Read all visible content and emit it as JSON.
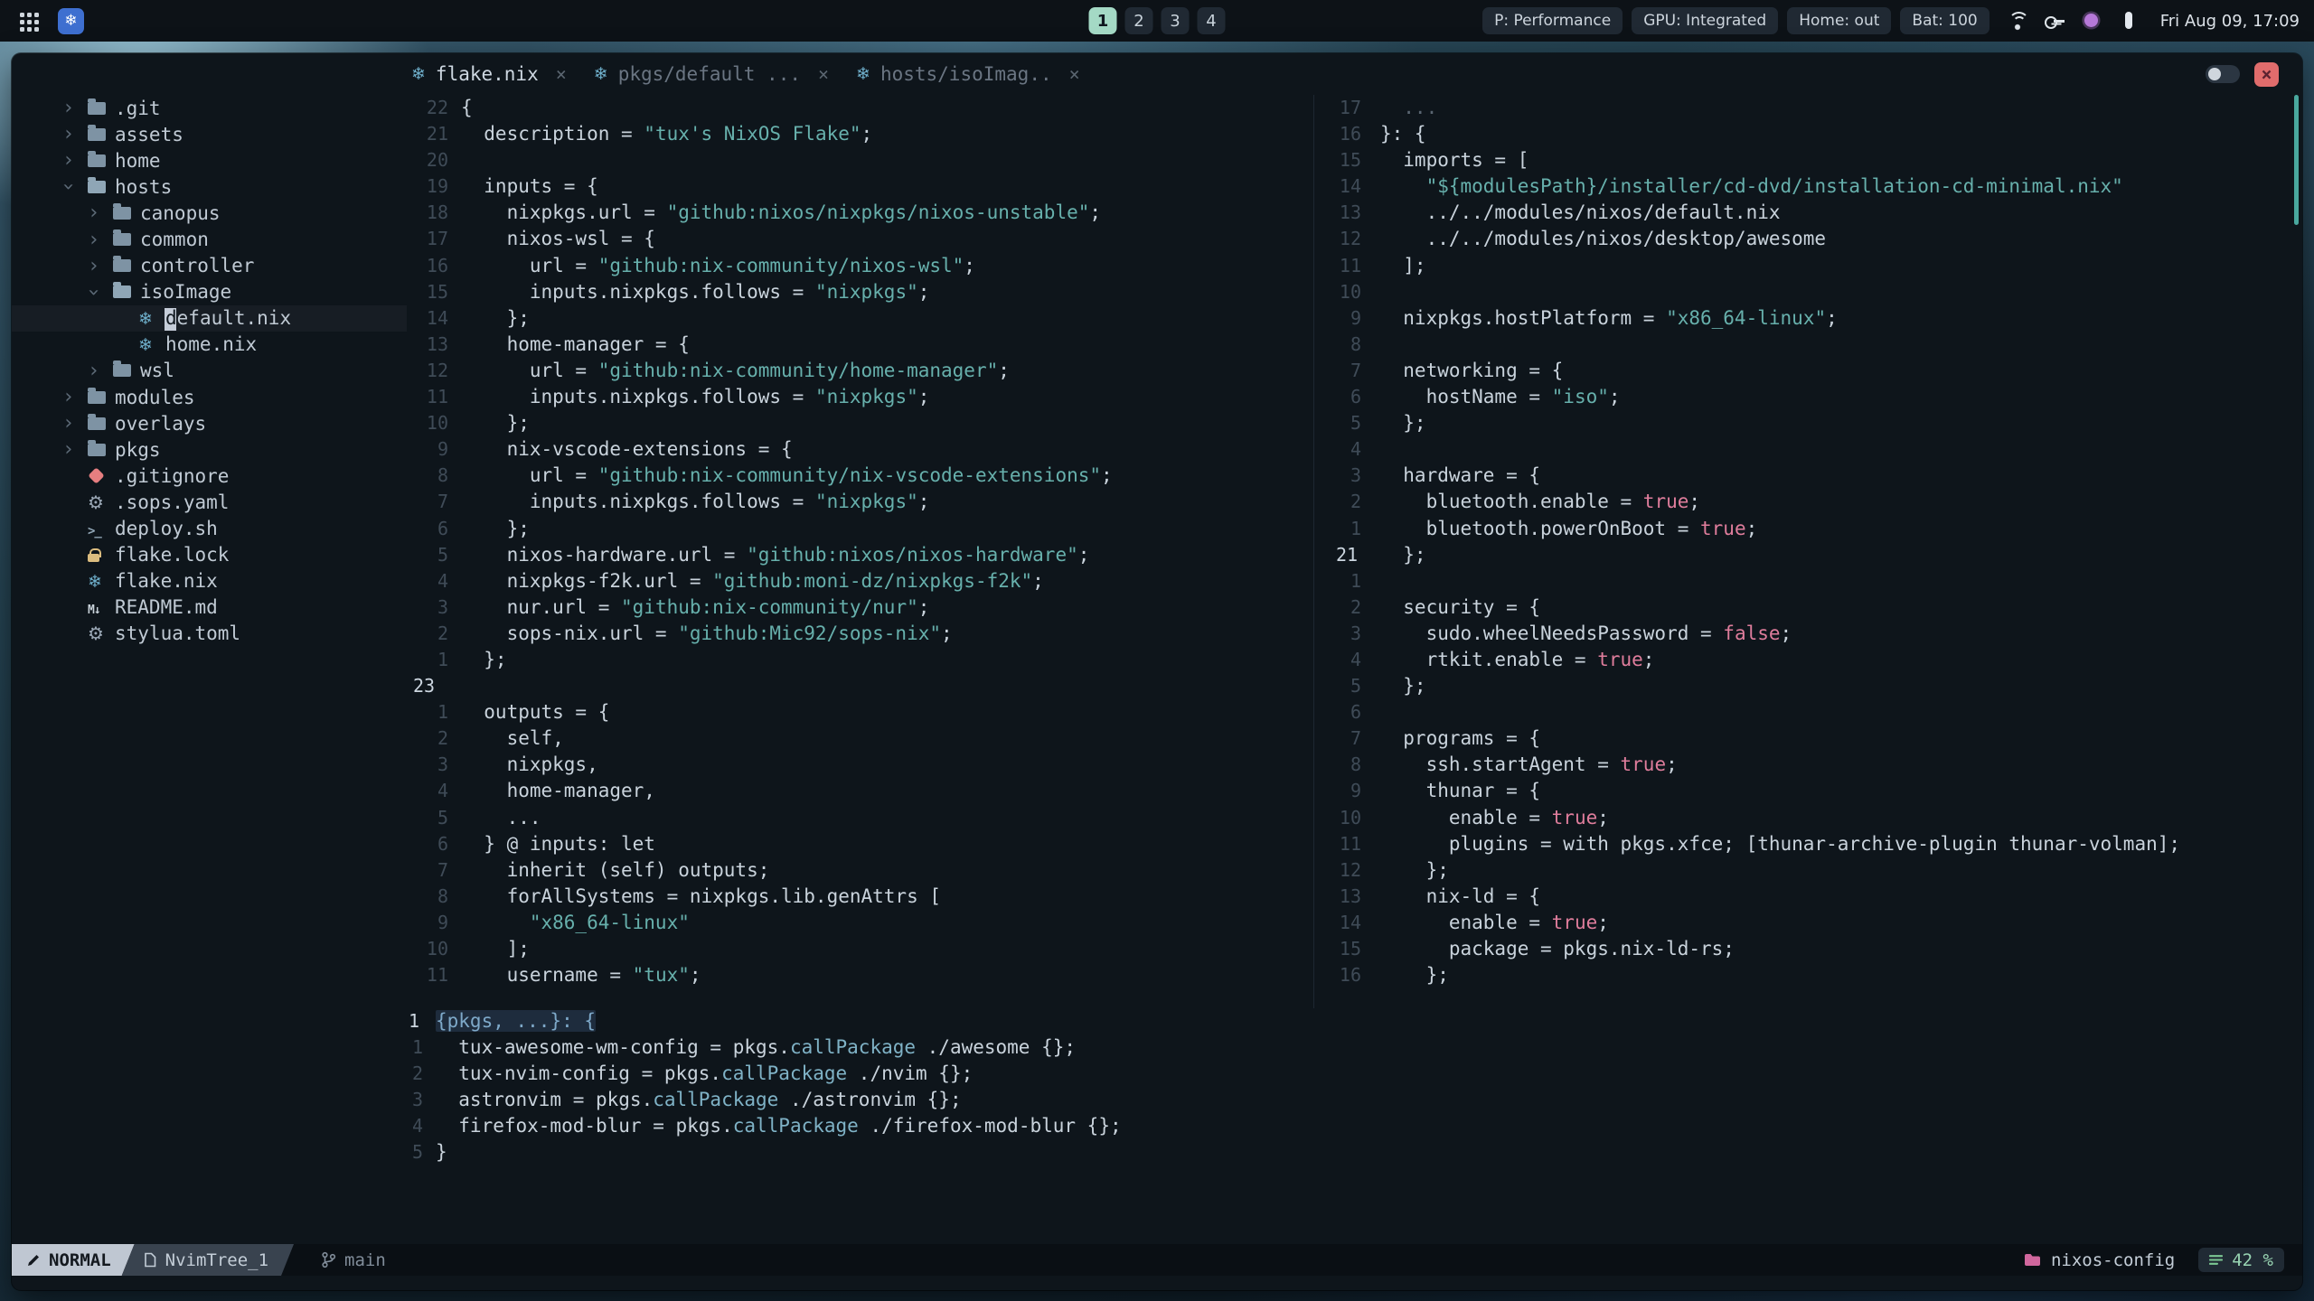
{
  "colors": {
    "accent_teal": "#a4d9c5",
    "string_teal": "#67b0ac",
    "boolean_pink": "#df7d9c",
    "close_red": "#e06c6c",
    "folder_pink": "#d0679d",
    "nix_blue": "#6fb0cc",
    "badge_blue": "#3e6fd0",
    "progress_green": "#8fd0a8",
    "scrollbar_teal": "#49a89e"
  },
  "topbar": {
    "workspaces": [
      {
        "label": "1",
        "active": true
      },
      {
        "label": "2",
        "active": false
      },
      {
        "label": "3",
        "active": false
      },
      {
        "label": "4",
        "active": false
      }
    ],
    "status_chips": [
      "P: Performance",
      "GPU: Integrated",
      "Home: out",
      "Bat: 100"
    ],
    "tray": [
      {
        "icon": "wifi",
        "name": "wifi-icon"
      },
      {
        "icon": "vpn",
        "name": "vpn-icon"
      },
      {
        "icon": "accent",
        "name": "color-dot-icon"
      },
      {
        "icon": "panel",
        "name": "panel-icon"
      }
    ],
    "clock": "Fri Aug 09, 17:09"
  },
  "window": {
    "close_glyph": "×",
    "tabs": [
      {
        "label": "flake.nix",
        "icon": "nix",
        "close": "×",
        "active": true
      },
      {
        "label": "pkgs/default ...",
        "icon": "nix",
        "close": "×",
        "active": false
      },
      {
        "label": "hosts/isoImag..",
        "icon": "nix",
        "close": "×",
        "active": false
      }
    ]
  },
  "tree": {
    "items": [
      {
        "indent": 0,
        "chev": "closed",
        "icon": "folder",
        "label": ".git"
      },
      {
        "indent": 0,
        "chev": "closed",
        "icon": "folder",
        "label": "assets"
      },
      {
        "indent": 0,
        "chev": "closed",
        "icon": "folder",
        "label": "home"
      },
      {
        "indent": 0,
        "chev": "open",
        "icon": "folder-open",
        "label": "hosts"
      },
      {
        "indent": 1,
        "chev": "closed",
        "icon": "folder",
        "label": "canopus"
      },
      {
        "indent": 1,
        "chev": "closed",
        "icon": "folder",
        "label": "common"
      },
      {
        "indent": 1,
        "chev": "closed",
        "icon": "folder",
        "label": "controller"
      },
      {
        "indent": 1,
        "chev": "open",
        "icon": "folder-open",
        "label": "isoImage"
      },
      {
        "indent": 2,
        "chev": "leaf",
        "icon": "nix",
        "label": "default.nix",
        "cursor": true
      },
      {
        "indent": 2,
        "chev": "leaf",
        "icon": "nix",
        "label": "home.nix"
      },
      {
        "indent": 1,
        "chev": "closed",
        "icon": "folder",
        "label": "wsl"
      },
      {
        "indent": 0,
        "chev": "closed",
        "icon": "folder",
        "label": "modules"
      },
      {
        "indent": 0,
        "chev": "closed",
        "icon": "folder",
        "label": "overlays"
      },
      {
        "indent": 0,
        "chev": "closed",
        "icon": "folder",
        "label": "pkgs"
      },
      {
        "indent": 0,
        "chev": "leaf",
        "icon": "git",
        "label": ".gitignore"
      },
      {
        "indent": 0,
        "chev": "leaf",
        "icon": "gear",
        "label": ".sops.yaml"
      },
      {
        "indent": 0,
        "chev": "leaf",
        "icon": "shell",
        "label": "deploy.sh"
      },
      {
        "indent": 0,
        "chev": "leaf",
        "icon": "lock",
        "label": "flake.lock"
      },
      {
        "indent": 0,
        "chev": "leaf",
        "icon": "nix",
        "label": "flake.nix"
      },
      {
        "indent": 0,
        "chev": "leaf",
        "icon": "markdown",
        "label": "README.md"
      },
      {
        "indent": 0,
        "chev": "leaf",
        "icon": "gear",
        "label": "stylua.toml"
      }
    ]
  },
  "editors": {
    "left": {
      "lines": [
        {
          "n": "22",
          "seg": [
            [
              "p",
              "{"
            ]
          ]
        },
        {
          "n": "21",
          "seg": [
            [
              "p",
              "  description = "
            ],
            [
              "s",
              "\"tux's NixOS Flake\""
            ],
            [
              "p",
              ";"
            ]
          ]
        },
        {
          "n": "20",
          "seg": []
        },
        {
          "n": "19",
          "seg": [
            [
              "p",
              "  inputs = {"
            ]
          ]
        },
        {
          "n": "18",
          "seg": [
            [
              "p",
              "    nixpkgs.url = "
            ],
            [
              "s",
              "\"github:nixos/nixpkgs/nixos-unstable\""
            ],
            [
              "p",
              ";"
            ]
          ]
        },
        {
          "n": "17",
          "seg": [
            [
              "p",
              "    nixos-wsl = {"
            ]
          ]
        },
        {
          "n": "16",
          "seg": [
            [
              "p",
              "      url = "
            ],
            [
              "s",
              "\"github:nix-community/nixos-wsl\""
            ],
            [
              "p",
              ";"
            ]
          ]
        },
        {
          "n": "15",
          "seg": [
            [
              "p",
              "      inputs.nixpkgs.follows = "
            ],
            [
              "s",
              "\"nixpkgs\""
            ],
            [
              "p",
              ";"
            ]
          ]
        },
        {
          "n": "14",
          "seg": [
            [
              "p",
              "    };"
            ]
          ]
        },
        {
          "n": "13",
          "seg": [
            [
              "p",
              "    home-manager = {"
            ]
          ]
        },
        {
          "n": "12",
          "seg": [
            [
              "p",
              "      url = "
            ],
            [
              "s",
              "\"github:nix-community/home-manager\""
            ],
            [
              "p",
              ";"
            ]
          ]
        },
        {
          "n": "11",
          "seg": [
            [
              "p",
              "      inputs.nixpkgs.follows = "
            ],
            [
              "s",
              "\"nixpkgs\""
            ],
            [
              "p",
              ";"
            ]
          ]
        },
        {
          "n": "10",
          "seg": [
            [
              "p",
              "    };"
            ]
          ]
        },
        {
          "n": "9",
          "seg": [
            [
              "p",
              "    nix-vscode-extensions = {"
            ]
          ]
        },
        {
          "n": "8",
          "seg": [
            [
              "p",
              "      url = "
            ],
            [
              "s",
              "\"github:nix-community/nix-vscode-extensions\""
            ],
            [
              "p",
              ";"
            ]
          ]
        },
        {
          "n": "7",
          "seg": [
            [
              "p",
              "      inputs.nixpkgs.follows = "
            ],
            [
              "s",
              "\"nixpkgs\""
            ],
            [
              "p",
              ";"
            ]
          ]
        },
        {
          "n": "6",
          "seg": [
            [
              "p",
              "    };"
            ]
          ]
        },
        {
          "n": "5",
          "seg": [
            [
              "p",
              "    nixos-hardware.url = "
            ],
            [
              "s",
              "\"github:nixos/nixos-hardware\""
            ],
            [
              "p",
              ";"
            ]
          ]
        },
        {
          "n": "4",
          "seg": [
            [
              "p",
              "    nixpkgs-f2k.url = "
            ],
            [
              "s",
              "\"github:moni-dz/nixpkgs-f2k\""
            ],
            [
              "p",
              ";"
            ]
          ]
        },
        {
          "n": "3",
          "seg": [
            [
              "p",
              "    nur.url = "
            ],
            [
              "s",
              "\"github:nix-community/nur\""
            ],
            [
              "p",
              ";"
            ]
          ]
        },
        {
          "n": "2",
          "seg": [
            [
              "p",
              "    sops-nix.url = "
            ],
            [
              "s",
              "\"github:Mic92/sops-nix\""
            ],
            [
              "p",
              ";"
            ]
          ]
        },
        {
          "n": "1",
          "seg": [
            [
              "p",
              "  };"
            ]
          ]
        },
        {
          "n": "23",
          "cur": true,
          "seg": []
        },
        {
          "n": "1",
          "seg": [
            [
              "p",
              "  outputs = {"
            ]
          ]
        },
        {
          "n": "2",
          "seg": [
            [
              "p",
              "    self,"
            ]
          ]
        },
        {
          "n": "3",
          "seg": [
            [
              "p",
              "    nixpkgs,"
            ]
          ]
        },
        {
          "n": "4",
          "seg": [
            [
              "p",
              "    home-manager,"
            ]
          ]
        },
        {
          "n": "5",
          "seg": [
            [
              "p",
              "    ..."
            ]
          ]
        },
        {
          "n": "6",
          "seg": [
            [
              "p",
              "  } @ inputs: let"
            ]
          ]
        },
        {
          "n": "7",
          "seg": [
            [
              "p",
              "    inherit (self) outputs;"
            ]
          ]
        },
        {
          "n": "8",
          "seg": [
            [
              "p",
              "    forAllSystems = nixpkgs.lib.genAttrs ["
            ]
          ]
        },
        {
          "n": "9",
          "seg": [
            [
              "p",
              "      "
            ],
            [
              "s",
              "\"x86_64-linux\""
            ]
          ]
        },
        {
          "n": "10",
          "seg": [
            [
              "p",
              "    ];"
            ]
          ]
        },
        {
          "n": "11",
          "seg": [
            [
              "p",
              "    username = "
            ],
            [
              "s",
              "\"tux\""
            ],
            [
              "p",
              ";"
            ]
          ]
        }
      ]
    },
    "right": {
      "lines": [
        {
          "n": "17",
          "seg": [
            [
              "d",
              "  ..."
            ]
          ]
        },
        {
          "n": "16",
          "seg": [
            [
              "p",
              "}: {"
            ]
          ]
        },
        {
          "n": "15",
          "seg": [
            [
              "p",
              "  imports = ["
            ]
          ]
        },
        {
          "n": "14",
          "seg": [
            [
              "p",
              "    "
            ],
            [
              "s",
              "\"${modulesPath}/installer/cd-dvd/installation-cd-minimal.nix\""
            ]
          ]
        },
        {
          "n": "13",
          "seg": [
            [
              "p",
              "    ../../modules/nixos/default.nix"
            ]
          ]
        },
        {
          "n": "12",
          "seg": [
            [
              "p",
              "    ../../modules/nixos/desktop/awesome"
            ]
          ]
        },
        {
          "n": "11",
          "seg": [
            [
              "p",
              "  ];"
            ]
          ]
        },
        {
          "n": "10",
          "seg": []
        },
        {
          "n": "9",
          "seg": [
            [
              "p",
              "  nixpkgs.hostPlatform = "
            ],
            [
              "s",
              "\"x86_64-linux\""
            ],
            [
              "p",
              ";"
            ]
          ]
        },
        {
          "n": "8",
          "seg": []
        },
        {
          "n": "7",
          "seg": [
            [
              "p",
              "  networking = {"
            ]
          ]
        },
        {
          "n": "6",
          "seg": [
            [
              "p",
              "    hostName = "
            ],
            [
              "s",
              "\"iso\""
            ],
            [
              "p",
              ";"
            ]
          ]
        },
        {
          "n": "5",
          "seg": [
            [
              "p",
              "  };"
            ]
          ]
        },
        {
          "n": "4",
          "seg": []
        },
        {
          "n": "3",
          "seg": [
            [
              "p",
              "  hardware = {"
            ]
          ]
        },
        {
          "n": "2",
          "seg": [
            [
              "p",
              "    bluetooth.enable = "
            ],
            [
              "b",
              "true"
            ],
            [
              "p",
              ";"
            ]
          ]
        },
        {
          "n": "1",
          "seg": [
            [
              "p",
              "    bluetooth.powerOnBoot = "
            ],
            [
              "b",
              "true"
            ],
            [
              "p",
              ";"
            ]
          ]
        },
        {
          "n": "21",
          "cur": true,
          "seg": [
            [
              "p",
              "  };"
            ]
          ]
        },
        {
          "n": "1",
          "seg": []
        },
        {
          "n": "2",
          "seg": [
            [
              "p",
              "  security = {"
            ]
          ]
        },
        {
          "n": "3",
          "seg": [
            [
              "p",
              "    sudo.wheelNeedsPassword = "
            ],
            [
              "b",
              "false"
            ],
            [
              "p",
              ";"
            ]
          ]
        },
        {
          "n": "4",
          "seg": [
            [
              "p",
              "    rtkit.enable = "
            ],
            [
              "b",
              "true"
            ],
            [
              "p",
              ";"
            ]
          ]
        },
        {
          "n": "5",
          "seg": [
            [
              "p",
              "  };"
            ]
          ]
        },
        {
          "n": "6",
          "seg": []
        },
        {
          "n": "7",
          "seg": [
            [
              "p",
              "  programs = {"
            ]
          ]
        },
        {
          "n": "8",
          "seg": [
            [
              "p",
              "    ssh.startAgent = "
            ],
            [
              "b",
              "true"
            ],
            [
              "p",
              ";"
            ]
          ]
        },
        {
          "n": "9",
          "seg": [
            [
              "p",
              "    thunar = {"
            ]
          ]
        },
        {
          "n": "10",
          "seg": [
            [
              "p",
              "      enable = "
            ],
            [
              "b",
              "true"
            ],
            [
              "p",
              ";"
            ]
          ]
        },
        {
          "n": "11",
          "seg": [
            [
              "p",
              "      plugins = with pkgs.xfce; [thunar-archive-plugin thunar-volman];"
            ]
          ]
        },
        {
          "n": "12",
          "seg": [
            [
              "p",
              "    };"
            ]
          ]
        },
        {
          "n": "13",
          "seg": [
            [
              "p",
              "    nix-ld = {"
            ]
          ]
        },
        {
          "n": "14",
          "seg": [
            [
              "p",
              "      enable = "
            ],
            [
              "b",
              "true"
            ],
            [
              "p",
              ";"
            ]
          ]
        },
        {
          "n": "15",
          "seg": [
            [
              "p",
              "      package = pkgs.nix-ld-rs;"
            ]
          ]
        },
        {
          "n": "16",
          "seg": [
            [
              "p",
              "    };"
            ]
          ]
        }
      ]
    },
    "bottom": {
      "lines": [
        {
          "n": "1",
          "cur": true,
          "seg": [
            [
              "v",
              "{pkgs, ...}: {"
            ]
          ]
        },
        {
          "n": "1",
          "seg": [
            [
              "p",
              "  tux-awesome-wm-config = pkgs."
            ],
            [
              "f",
              "callPackage"
            ],
            [
              "p",
              " ./awesome {};"
            ]
          ]
        },
        {
          "n": "2",
          "seg": [
            [
              "p",
              "  tux-nvim-config = pkgs."
            ],
            [
              "f",
              "callPackage"
            ],
            [
              "p",
              " ./nvim {};"
            ]
          ]
        },
        {
          "n": "3",
          "seg": [
            [
              "p",
              "  astronvim = pkgs."
            ],
            [
              "f",
              "callPackage"
            ],
            [
              "p",
              " ./astronvim {};"
            ]
          ]
        },
        {
          "n": "4",
          "seg": [
            [
              "p",
              "  firefox-mod-blur = pkgs."
            ],
            [
              "f",
              "callPackage"
            ],
            [
              "p",
              " ./firefox-mod-blur {};"
            ]
          ]
        },
        {
          "n": "5",
          "seg": [
            [
              "p",
              "}"
            ]
          ]
        }
      ]
    }
  },
  "statusbar": {
    "mode": "NORMAL",
    "buffer": "NvimTree_1",
    "branch": "main",
    "project": "nixos-config",
    "progress": "42 %"
  }
}
